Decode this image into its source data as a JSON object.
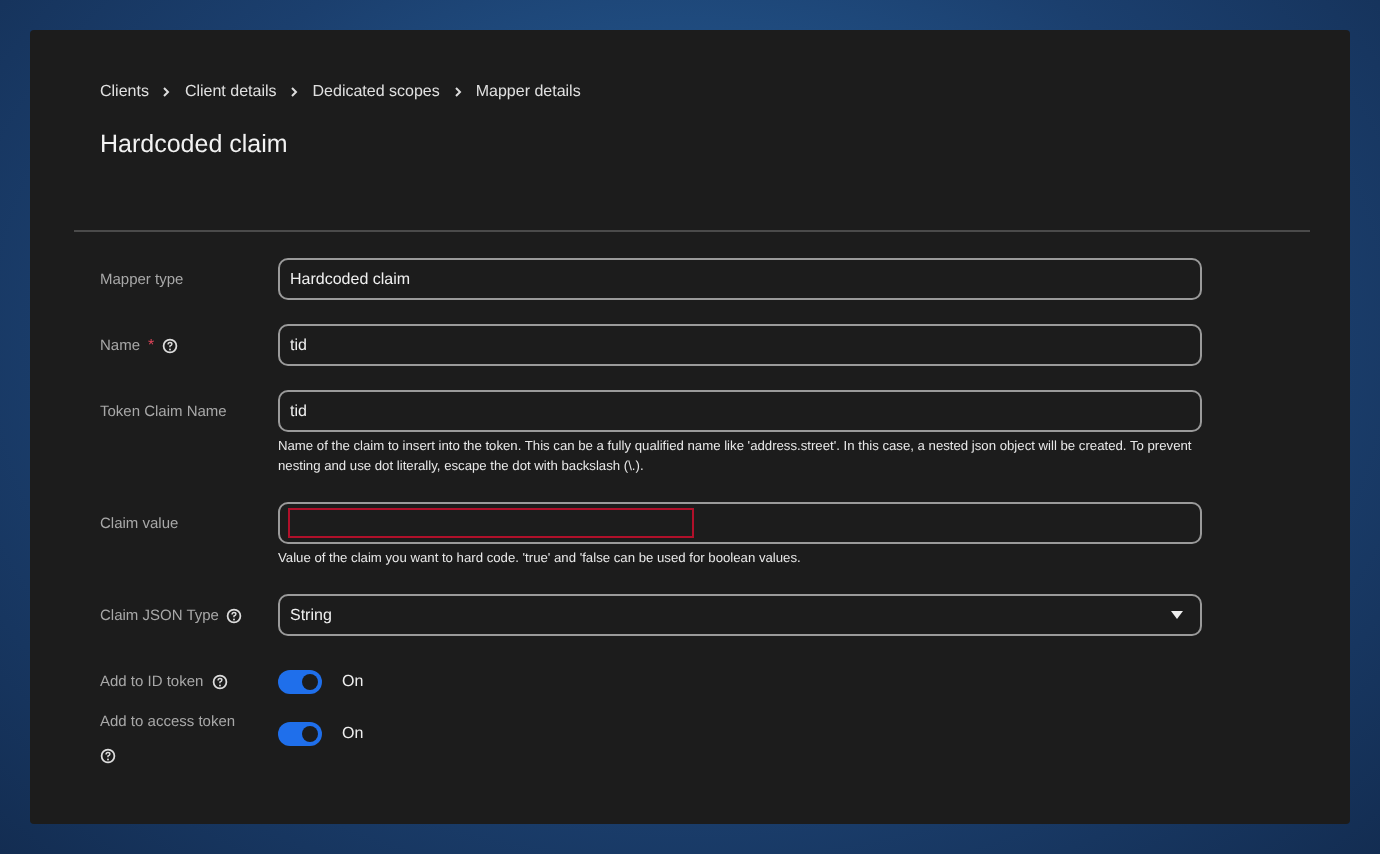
{
  "breadcrumb": [
    "Clients",
    "Client details",
    "Dedicated scopes",
    "Mapper details"
  ],
  "title": "Hardcoded claim",
  "fields": [
    {
      "kind": "text",
      "label": "Mapper type",
      "help_icon": false,
      "value": "Hardcoded claim",
      "highlighted": false
    },
    {
      "kind": "text",
      "label": "Name",
      "required_mark": "*",
      "help_icon": true,
      "value": "tid",
      "highlighted": false
    },
    {
      "kind": "text",
      "label": "Token Claim Name",
      "help_icon": false,
      "value": "tid",
      "highlighted": false,
      "helper": "Name of the claim to insert into the token. This can be a fully qualified name like 'address.street'. In this case, a nested json object will be created. To prevent nesting and use dot literally, escape the dot with backslash (\\.)."
    },
    {
      "kind": "text",
      "label": "Claim value",
      "help_icon": false,
      "highlighted": true,
      "helper": "Value of the claim you want to hard code. 'true' and 'false can be used for boolean values."
    },
    {
      "kind": "select",
      "label": "Claim JSON Type",
      "help_icon": true,
      "value": "String"
    },
    {
      "kind": "toggle",
      "label": "Add to ID token",
      "help_icon": true,
      "on": true,
      "state_label": "On"
    },
    {
      "kind": "toggle",
      "label": "Add to access token",
      "help_icon": true,
      "on": true,
      "state_label": "On",
      "icon_below": true
    }
  ]
}
